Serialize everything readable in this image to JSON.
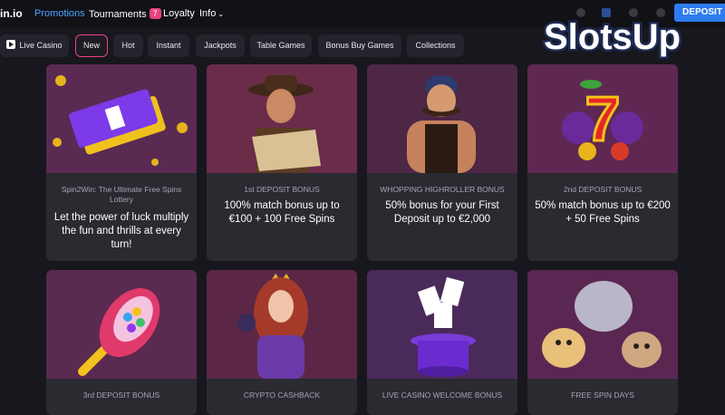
{
  "header": {
    "logo": "in.io",
    "nav": [
      {
        "label": "Promotions",
        "active": true
      },
      {
        "label": "Tournaments",
        "badge": "7"
      },
      {
        "label": "Loyalty"
      },
      {
        "label": "Info",
        "has_dropdown": true
      }
    ],
    "deposit_label": "DEPOSIT",
    "accent": "#4aa6ff",
    "deposit_color": "#2d7cf0"
  },
  "watermark": {
    "text": "SlotsUp"
  },
  "filters": [
    {
      "label": "Live Casino",
      "icon": "play-icon"
    },
    {
      "label": "New",
      "selected": true
    },
    {
      "label": "Hot"
    },
    {
      "label": "Instant"
    },
    {
      "label": "Jackpots"
    },
    {
      "label": "Table Games"
    },
    {
      "label": "Bonus Buy Games"
    },
    {
      "label": "Collections"
    }
  ],
  "promotions": [
    {
      "subtitle": "Spin2Win: The Ultimate Free Spins Lottery",
      "title": "Let the power of luck multiply the fun and thrills at every turn!",
      "image": "golden-tickets-art"
    },
    {
      "subtitle": "1st DEPOSIT BONUS",
      "title": "100% match bonus up to €100 + 100 Free Spins",
      "image": "adventurer-map-art"
    },
    {
      "subtitle": "WHOPPING HIGHROLLER BONUS",
      "title": "50% bonus for your First Deposit up to €2,000",
      "image": "strongman-art"
    },
    {
      "subtitle": "2nd DEPOSIT BONUS",
      "title": "50% match bonus up to €200 + 50 Free Spins",
      "image": "lucky-seven-art"
    },
    {
      "subtitle": "3rd DEPOSIT BONUS",
      "title": "",
      "image": "gumball-rocket-art"
    },
    {
      "subtitle": "CRYPTO CASHBACK",
      "title": "",
      "image": "queen-art"
    },
    {
      "subtitle": "LIVE CASINO WELCOME BONUS",
      "title": "",
      "image": "magic-hat-cards-art"
    },
    {
      "subtitle": "FREE SPIN DAYS",
      "title": "",
      "image": "dogs-art"
    }
  ]
}
